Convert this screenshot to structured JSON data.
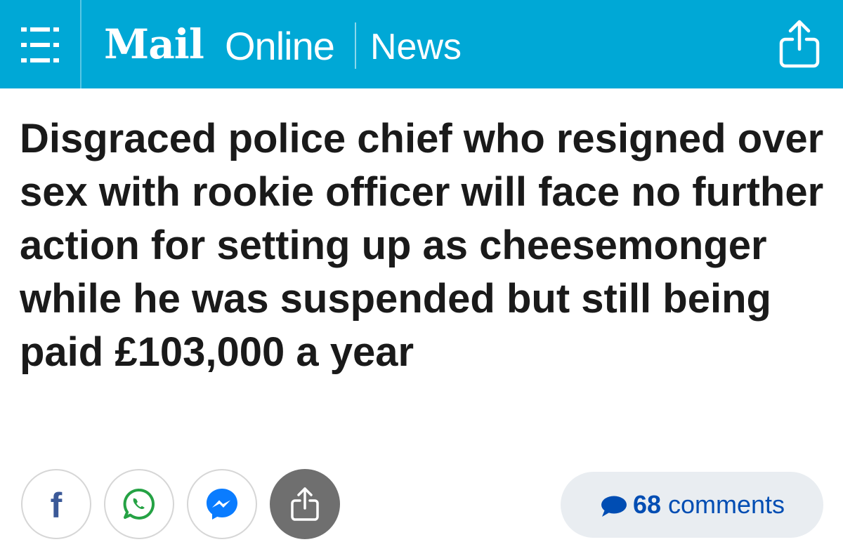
{
  "header": {
    "logo_mail": "Mail",
    "logo_online": "Online",
    "section": "News",
    "background_color": "#00a8d6"
  },
  "article": {
    "headline": "Disgraced police chief who resigned over sex with rookie officer will face no further action for setting up as cheesemonger while he was suspended but still being paid £103,000 a year"
  },
  "share_bar": {
    "facebook_glyph": "f",
    "icons": [
      "facebook-icon",
      "whatsapp-icon",
      "messenger-icon",
      "share-icon"
    ],
    "comments_count": "68",
    "comments_label": "comments",
    "comments_color": "#004db3"
  }
}
